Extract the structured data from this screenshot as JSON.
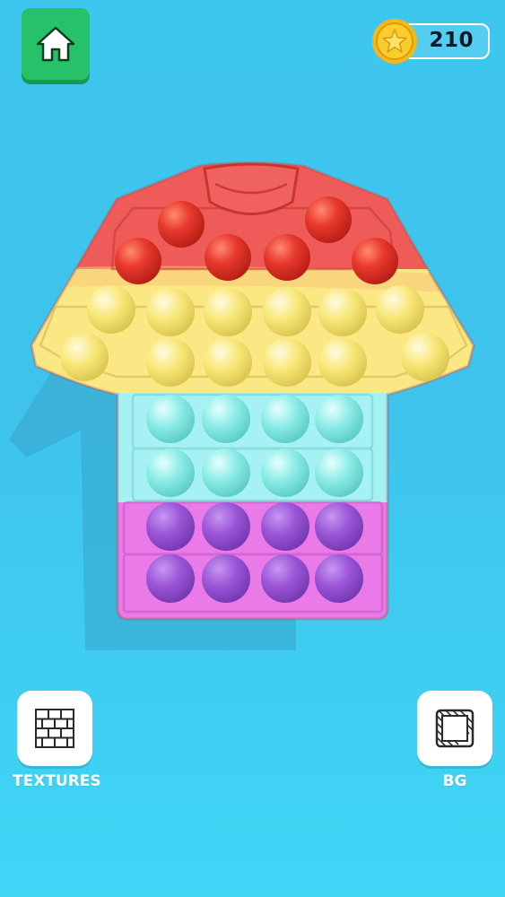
{
  "hud": {
    "coins": "210",
    "home_icon": "home-icon",
    "coin_icon": "star-coin-icon"
  },
  "toy": {
    "shape": "t-shirt",
    "rows": [
      {
        "color": "#e8392e",
        "bubbles": 6
      },
      {
        "color": "#f8e777",
        "bubbles": 6
      },
      {
        "color": "#f8e777",
        "bubbles": 6
      },
      {
        "color": "#8bece6",
        "bubbles": 4
      },
      {
        "color": "#8bece6",
        "bubbles": 4
      },
      {
        "color": "#9a55d6",
        "bubbles": 4
      },
      {
        "color": "#9a55d6",
        "bubbles": 4
      }
    ]
  },
  "buttons": {
    "textures_label": "TEXTURES",
    "bg_label": "BG",
    "textures_icon": "brick-texture-icon",
    "bg_icon": "striped-square-icon"
  },
  "colors": {
    "background": "#3fc3ec",
    "home_button": "#27c16a",
    "red_band": "#ef5b58",
    "yellow_band": "#fbe884",
    "cyan_band": "#a6f1f3",
    "pink_band": "#e97ae8"
  }
}
